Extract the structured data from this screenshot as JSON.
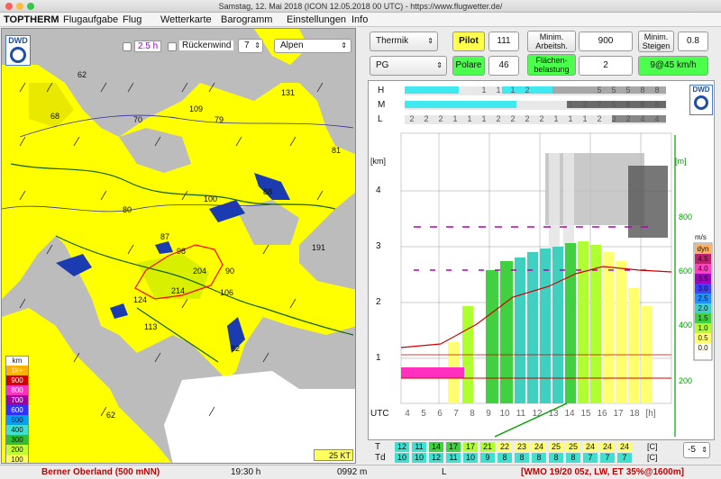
{
  "window": {
    "title": "Samstag, 12. Mai 2018 (ICON 12.05.2018 00 UTC) - https://www.flugwetter.de/"
  },
  "menu": [
    "TOPTHERM",
    "Flugaufgabe",
    "Flug",
    "Wetterkarte",
    "Barogramm",
    "Einstellungen",
    "Info"
  ],
  "map": {
    "logo": "DWD",
    "time_checkbox_label": "2.5 h",
    "wind_checkbox_label": "Rückenwind",
    "level_value": "7",
    "region_value": "Alpen",
    "legend_unit": "km",
    "legend": [
      {
        "label": "1k+",
        "color": "#ffb000"
      },
      {
        "label": "900",
        "color": "#d00000"
      },
      {
        "label": "800",
        "color": "#ff30c0"
      },
      {
        "label": "700",
        "color": "#a000a0"
      },
      {
        "label": "600",
        "color": "#3030ff"
      },
      {
        "label": "500",
        "color": "#00a0ff"
      },
      {
        "label": "400",
        "color": "#40e0d0"
      },
      {
        "label": "300",
        "color": "#30c030"
      },
      {
        "label": "200",
        "color": "#c0ff30"
      },
      {
        "label": "100",
        "color": "#ffff60"
      }
    ],
    "scale_label": "25 KT",
    "labels": [
      "62",
      "131",
      "68",
      "70",
      "109",
      "79",
      "81",
      "80",
      "100",
      "88",
      "87",
      "98",
      "191",
      "90",
      "204",
      "124",
      "214",
      "106",
      "113",
      "82",
      "62"
    ]
  },
  "controls": {
    "mode_value": "Thermik",
    "pilot_label": "Pilot",
    "pilot_value": "111",
    "min_work_label": "Minim. Arbeitsh.",
    "min_work_value": "900",
    "min_climb_label": "Minim. Steigen",
    "min_climb_value": "0.8",
    "aircraft_value": "PG",
    "polar_label": "Polare",
    "polar_value": "46",
    "wing_load_label": "Flächen- belastung",
    "wing_load_value": "2",
    "result_value": "9@45 km/h"
  },
  "sounding": {
    "logo": "DWD",
    "cloud_rows": [
      {
        "label": "H",
        "values": [
          "",
          "",
          "",
          "",
          "",
          "1",
          "1",
          "1",
          "2",
          "",
          "",
          "",
          "",
          "5",
          "5",
          "5",
          "8",
          "8"
        ]
      },
      {
        "label": "M",
        "values": [
          "",
          "",
          "",
          "",
          "",
          "",
          "",
          "",
          "",
          "",
          "",
          "1",
          "2",
          "7",
          "5",
          "8",
          "8",
          "8"
        ]
      },
      {
        "label": "L",
        "values": [
          "2",
          "2",
          "2",
          "1",
          "1",
          "1",
          "2",
          "2",
          "2",
          "2",
          "1",
          "1",
          "1",
          "2",
          "3",
          "2",
          "4",
          "4"
        ]
      }
    ],
    "y_unit_left": "[km]",
    "y_ticks_left": [
      "4",
      "3",
      "2",
      "1"
    ],
    "y_unit_right": "[m]",
    "y_ticks_right": [
      "800",
      "600",
      "400",
      "200"
    ],
    "x_label": "UTC",
    "x_ticks": [
      "4",
      "5",
      "6",
      "7",
      "8",
      "9",
      "10",
      "11",
      "12",
      "13",
      "14",
      "15",
      "16",
      "17",
      "18",
      "[h]"
    ],
    "climb_unit": "m/s",
    "climb_legend": [
      {
        "label": "dyn",
        "color": "#ffb060"
      },
      {
        "label": "4.5",
        "color": "#c02070"
      },
      {
        "label": "4.0",
        "color": "#ff40c0"
      },
      {
        "label": "3.5",
        "color": "#a000c0"
      },
      {
        "label": "3.0",
        "color": "#4040ff"
      },
      {
        "label": "2.5",
        "color": "#2090ff"
      },
      {
        "label": "2.0",
        "color": "#40d0d0"
      },
      {
        "label": "1.5",
        "color": "#40d040"
      },
      {
        "label": "1.0",
        "color": "#b0ff30"
      },
      {
        "label": "0.5",
        "color": "#ffff70"
      },
      {
        "label": "0.0",
        "color": "#fffff0"
      }
    ],
    "t_label": "T",
    "td_label": "Td",
    "t_values": [
      "12",
      "11",
      "14",
      "17",
      "17",
      "21",
      "22",
      "23",
      "24",
      "25",
      "25",
      "24",
      "24",
      "24"
    ],
    "td_values": [
      "10",
      "10",
      "12",
      "11",
      "10",
      "9",
      "8",
      "8",
      "8",
      "8",
      "8",
      "7",
      "7",
      "7"
    ],
    "unit_c": "[C]",
    "offset_value": "-5"
  },
  "status": {
    "location": "Berner Oberland (500 mNN)",
    "time": "19:30 h",
    "altitude": "0992 m",
    "code": "L",
    "station": "[WMO 19/20 05z, LW, ET  35%@1600m]"
  }
}
